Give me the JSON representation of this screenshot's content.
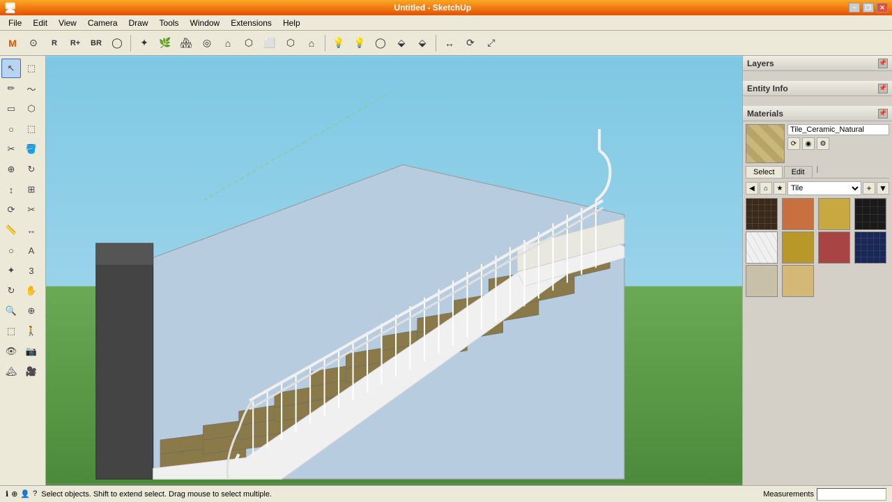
{
  "titlebar": {
    "title": "Untitled - SketchUp",
    "min_label": "−",
    "restore_label": "❐",
    "close_label": "✕"
  },
  "menubar": {
    "items": [
      "File",
      "Edit",
      "View",
      "Camera",
      "Draw",
      "Tools",
      "Window",
      "Extensions",
      "Help"
    ]
  },
  "toolbar": {
    "groups": [
      [
        "M",
        "⊙",
        "R",
        "R+",
        "BR",
        "◯",
        "≡",
        "✦",
        "🌿",
        "🌿",
        "◎",
        "🏠"
      ],
      [
        "⌂",
        "⬡",
        "⬜",
        "⬡",
        "⬡",
        "⯃"
      ],
      [
        "💡",
        "💡",
        "◯",
        "💡",
        "💡",
        "◯",
        "↔",
        "⟳",
        "⤢"
      ]
    ]
  },
  "left_toolbar": {
    "tools": [
      {
        "icon": "↖",
        "name": "select",
        "active": true
      },
      {
        "icon": "⬚",
        "name": "space"
      },
      {
        "icon": "✏",
        "name": "pencil"
      },
      {
        "icon": "〜",
        "name": "arc"
      },
      {
        "icon": "⬚",
        "name": "rectangle"
      },
      {
        "icon": "⬡",
        "name": "polygon"
      },
      {
        "icon": "○",
        "name": "circle"
      },
      {
        "icon": "⬚",
        "name": "offset"
      },
      {
        "icon": "✂",
        "name": "eraser"
      },
      {
        "icon": "↕",
        "name": "move"
      },
      {
        "icon": "↻",
        "name": "rotate"
      },
      {
        "icon": "⊕",
        "name": "push"
      },
      {
        "icon": "⟳",
        "name": "follow"
      },
      {
        "icon": "⬚",
        "name": "scale"
      },
      {
        "icon": "⬚",
        "name": "offset2"
      },
      {
        "icon": "⊞",
        "name": "intersect"
      },
      {
        "icon": "📏",
        "name": "measure"
      },
      {
        "icon": "🔭",
        "name": "zoom"
      },
      {
        "icon": "🏠",
        "name": "home"
      },
      {
        "icon": "🔍",
        "name": "orbit"
      }
    ]
  },
  "panels": {
    "layers": {
      "title": "Layers",
      "pin_icon": "📌"
    },
    "entity_info": {
      "title": "Entity Info",
      "pin_icon": "📌"
    },
    "materials": {
      "title": "Materials",
      "pin_icon": "📌",
      "current_material": "Tile_Ceramic_Natural",
      "tabs": [
        "Select",
        "Edit"
      ],
      "active_tab": "Select",
      "category": "Tile",
      "swatches": [
        {
          "color": "#4a3a2a",
          "pattern": "dark_tile"
        },
        {
          "color": "#c8704a",
          "pattern": "orange_tile"
        },
        {
          "color": "#c8a84a",
          "pattern": "tan_tile"
        },
        {
          "color": "#1a1a1a",
          "pattern": "black_tile"
        },
        {
          "color": "#f0f0f0",
          "pattern": "hex_white"
        },
        {
          "color": "#b8982a",
          "pattern": "gold_tile"
        },
        {
          "color": "#a84a4a",
          "pattern": "red_tile"
        },
        {
          "color": "#1a2a5a",
          "pattern": "navy_tile"
        },
        {
          "color": "#c8c0a8",
          "pattern": "light_tile"
        },
        {
          "color": "#d4b87a",
          "pattern": "beige_tile"
        },
        {
          "color": "#888",
          "pattern": "empty1"
        },
        {
          "color": "#888",
          "pattern": "empty2"
        }
      ]
    }
  },
  "statusbar": {
    "message": "Select objects. Shift to extend select. Drag mouse to select multiple.",
    "measurements_label": "Measurements",
    "icons": [
      "ℹ",
      "⊕",
      "👤",
      "?"
    ]
  }
}
